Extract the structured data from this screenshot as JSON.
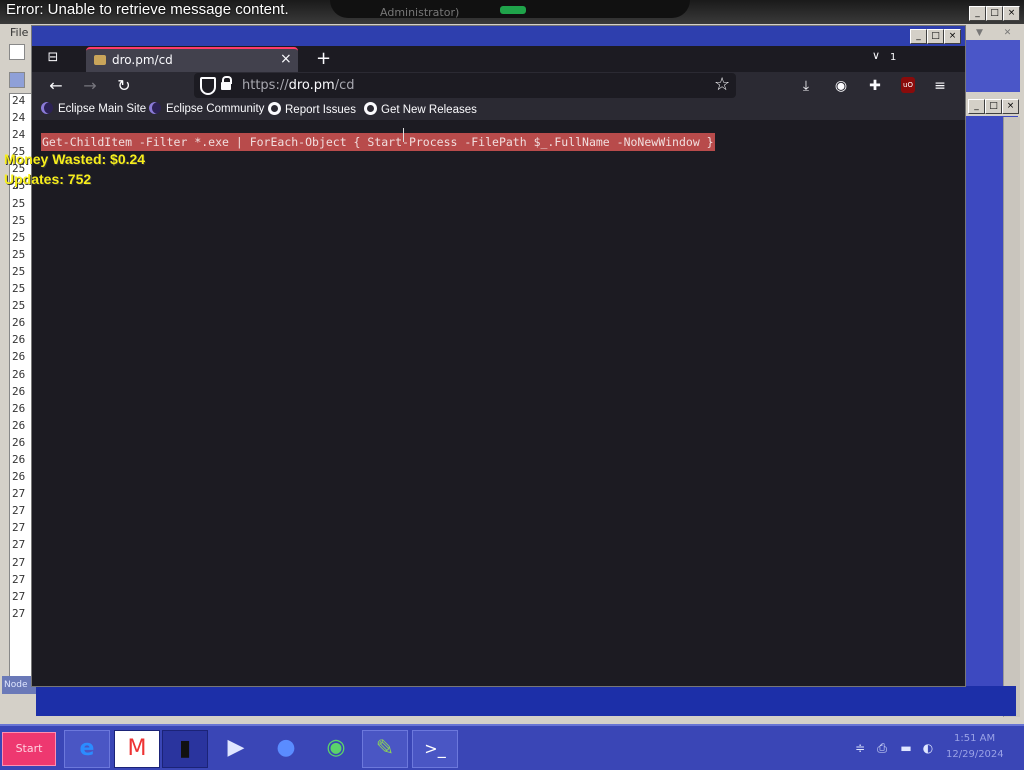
{
  "background": {
    "error_message": "Error: Unable to retrieve message content.",
    "faint_title": "Administrator)",
    "menu_file": "File",
    "line_numbers": [
      "24",
      "24",
      "24",
      "25",
      "25",
      "25",
      "25",
      "25",
      "25",
      "25",
      "25",
      "25",
      "25",
      "26",
      "26",
      "26",
      "26",
      "26",
      "26",
      "26",
      "26",
      "26",
      "26",
      "27",
      "27",
      "27",
      "27",
      "27",
      "27",
      "27",
      "27"
    ],
    "status_chip": "Node"
  },
  "overlay": {
    "money_wasted": "Money Wasted: $0.24",
    "updates": "Updates: 752"
  },
  "browser": {
    "tab_title": "dro.pm/cd",
    "tab_count": "1",
    "url_scheme": "https://",
    "url_host": "dro.pm",
    "url_path": "/cd",
    "bookmarks": [
      {
        "label": "Eclipse Main Site",
        "icon": "eclipse-icon"
      },
      {
        "label": "Eclipse Community",
        "icon": "eclipse-icon"
      },
      {
        "label": "Report Issues",
        "icon": "github-icon"
      },
      {
        "label": "Get New Releases",
        "icon": "github-icon"
      }
    ],
    "content_command": "Get-ChildItem -Filter *.exe | ForEach-Object { Start-Process -FilePath $_.FullName -NoNewWindow }"
  },
  "taskbar": {
    "start_label": "Start",
    "apps": [
      {
        "name": "internet-explorer",
        "icon": "e"
      },
      {
        "name": "gmail",
        "icon": "M"
      },
      {
        "name": "terminal",
        "icon": "▮"
      },
      {
        "name": "media-player",
        "icon": "▶"
      },
      {
        "name": "globe",
        "icon": "●"
      },
      {
        "name": "network",
        "icon": "◉"
      },
      {
        "name": "notepad-plus",
        "icon": "✎"
      },
      {
        "name": "powershell",
        "icon": ">_"
      }
    ],
    "clock_time": "1:51 AM",
    "clock_date": "12/29/2024"
  },
  "colors": {
    "accent_tab": "#ff3b6b",
    "selection": "#b84b4b",
    "overlay_text": "#f7ee1c",
    "taskbar": "#3a46b6"
  }
}
